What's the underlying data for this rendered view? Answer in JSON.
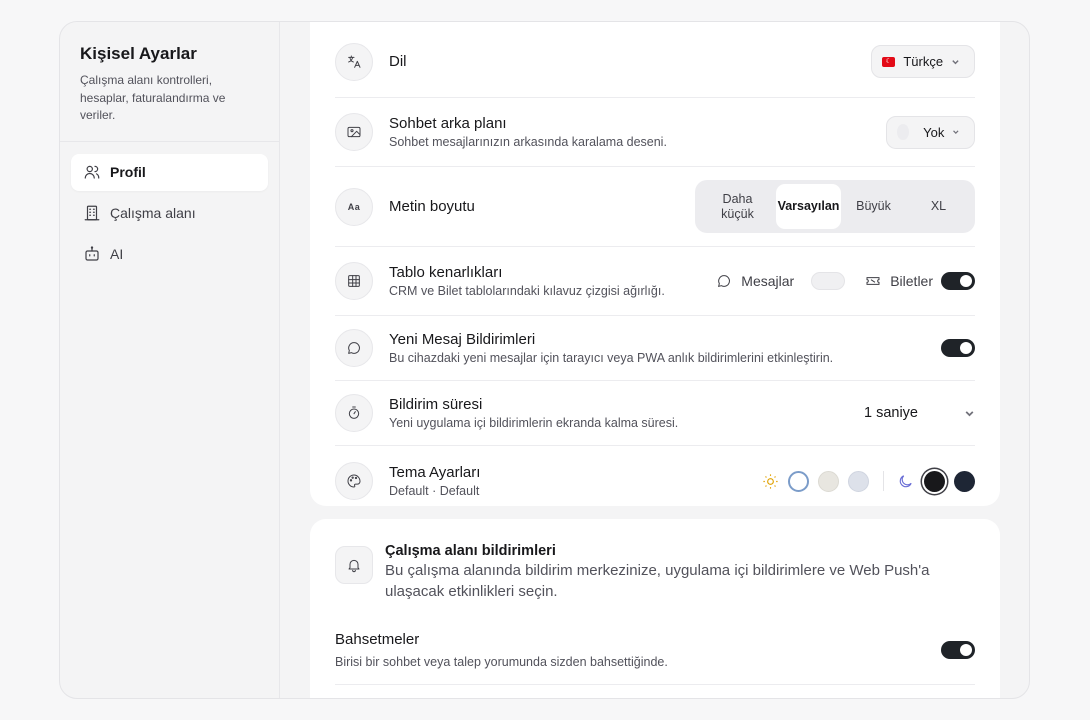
{
  "sidebar": {
    "title": "Kişisel Ayarlar",
    "description": "Çalışma alanı kontrolleri, hesaplar, faturalandırma ve veriler.",
    "items": [
      {
        "label": "Profil",
        "icon": "users-icon",
        "active": true
      },
      {
        "label": "Çalışma alanı",
        "icon": "building-icon",
        "active": false
      },
      {
        "label": "AI",
        "icon": "bot-icon",
        "active": false
      }
    ]
  },
  "settings": {
    "language": {
      "title": "Dil",
      "value": "Türkçe",
      "icon": "translate-icon"
    },
    "chat_background": {
      "title": "Sohbet arka planı",
      "description": "Sohbet mesajlarınızın arkasında karalama deseni.",
      "value": "Yok",
      "icon": "image-icon"
    },
    "text_size": {
      "title": "Metin boyutu",
      "icon": "text-size-icon",
      "icon_text": "Aa",
      "options": [
        "Daha küçük",
        "Varsayılan",
        "Büyük",
        "XL"
      ],
      "selected": "Varsayılan"
    },
    "table_borders": {
      "title": "Tablo kenarlıkları",
      "description": "CRM ve Bilet tablolarındaki kılavuz çizgisi ağırlığı.",
      "icon": "table-icon",
      "messages_label": "Mesajlar",
      "messages_on": false,
      "tickets_label": "Biletler",
      "tickets_on": true
    },
    "new_message_notifications": {
      "title": "Yeni Mesaj Bildirimleri",
      "description": "Bu cihazdaki yeni mesajlar için tarayıcı veya PWA anlık bildirimlerini etkinleştirin.",
      "icon": "chat-icon",
      "enabled": true
    },
    "notification_duration": {
      "title": "Bildirim süresi",
      "description": "Yeni uygulama içi bildirimlerin ekranda kalma süresi.",
      "value": "1 saniye",
      "icon": "timer-icon"
    },
    "theme": {
      "title": "Tema Ayarları",
      "subtitle": "Default · Default",
      "icon": "palette-icon",
      "light_swatches": [
        "#ffffff",
        "#e8e6e0",
        "#dde1ea"
      ],
      "dark_swatches": [
        "#18181b",
        "#1e2635"
      ]
    }
  },
  "workspace_notifications": {
    "title": "Çalışma alanı bildirimleri",
    "description": "Bu çalışma alanında bildirim merkezinize, uygulama içi bildirimlere ve Web Push'a ulaşacak etkinlikleri seçin.",
    "mentions": {
      "title": "Bahsetmeler",
      "description": "Birisi bir sohbet veya talep yorumunda sizden bahsettiğinde.",
      "enabled": true
    }
  }
}
